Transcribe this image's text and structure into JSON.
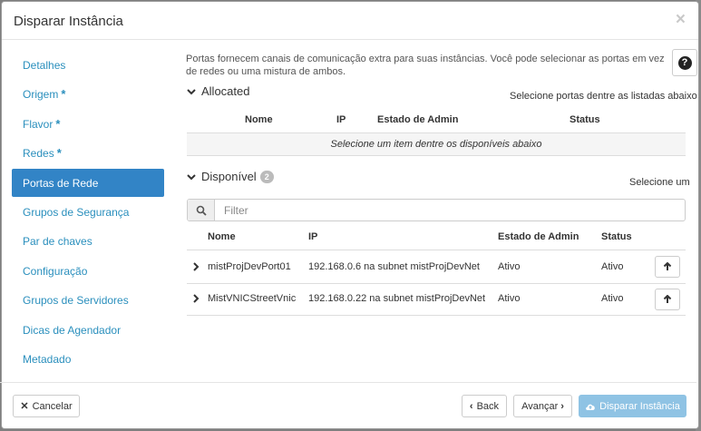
{
  "modal": {
    "title": "Disparar Instância",
    "close_glyph": "×"
  },
  "sidebar": {
    "items": [
      {
        "label": "Detalhes",
        "required": ""
      },
      {
        "label": "Origem",
        "required": "*"
      },
      {
        "label": "Flavor",
        "required": "*"
      },
      {
        "label": "Redes",
        "required": "*"
      },
      {
        "label": "Portas de Rede",
        "required": ""
      },
      {
        "label": "Grupos de Segurança",
        "required": ""
      },
      {
        "label": "Par de chaves",
        "required": ""
      },
      {
        "label": "Configuração",
        "required": ""
      },
      {
        "label": "Grupos de Servidores",
        "required": ""
      },
      {
        "label": "Dicas de Agendador",
        "required": ""
      },
      {
        "label": "Metadado",
        "required": ""
      }
    ],
    "active_index": 4
  },
  "content": {
    "description": "Portas fornecem canais de comunicação extra para suas instâncias. Você pode selecionar as portas em vez de redes ou uma mistura de ambos.",
    "help_glyph": "?",
    "allocated": {
      "title": "Allocated",
      "hint": "Selecione portas dentre as listadas abaixo",
      "columns": [
        "Nome",
        "IP",
        "Estado de Admin",
        "Status"
      ],
      "empty_message": "Selecione um item dentre os disponíveis abaixo"
    },
    "available": {
      "title": "Disponível",
      "count": "2",
      "hint": "Selecione um",
      "filter_placeholder": "Filter",
      "columns": [
        "Nome",
        "IP",
        "Estado de Admin",
        "Status"
      ],
      "rows": [
        {
          "name": "mistProjDevPort01",
          "ip": "192.168.0.6 na subnet mistProjDevNet",
          "admin_state": "Ativo",
          "status": "Ativo"
        },
        {
          "name": "MistVNICStreetVnic",
          "ip": "192.168.0.22 na subnet mistProjDevNet",
          "admin_state": "Ativo",
          "status": "Ativo"
        }
      ]
    }
  },
  "footer": {
    "cancel_label": "Cancelar",
    "back_label": "Back",
    "next_label": "Avançar",
    "launch_label": "Disparar Instância"
  },
  "icons": {
    "close": "close-icon",
    "help": "question-circle-icon",
    "section_toggle": "chevron-down-icon",
    "row_expand": "chevron-right-icon",
    "allocate": "arrow-up-icon",
    "filter": "search-icon",
    "cancel": "times-icon",
    "back": "chevron-left-icon",
    "next": "chevron-right-icon",
    "launch": "cloud-upload-icon"
  },
  "colors": {
    "accent": "#3284c6",
    "link": "#2a8fbd",
    "primary_button": "#8fc3e4"
  }
}
